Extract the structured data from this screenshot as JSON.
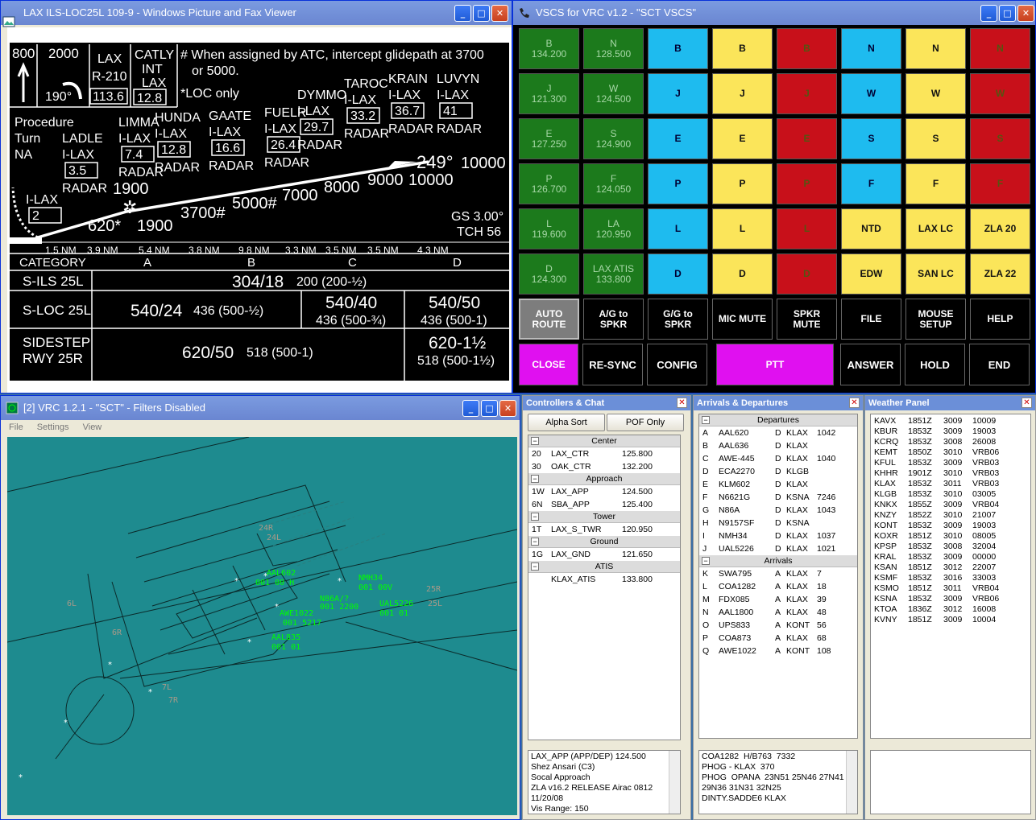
{
  "plate_window": {
    "title": "LAX ILS-LOC25L 109-9 - Windows Picture and Fax Viewer"
  },
  "plate": {
    "t800": "800",
    "t2000": "2000",
    "t190": "190°",
    "lax": "LAX",
    "r210": "R-210",
    "r1136": "113.6",
    "catly": "CATLY",
    "int": "INT",
    "catlylax": "LAX",
    "c128": "12.8",
    "note1": "# When assigned by ATC, intercept glidepath at 3700",
    "note2": "or 5000.",
    "note3": "*LOC only",
    "proc1": "Procedure",
    "proc2": "Turn",
    "proc3": "NA",
    "fixes": [
      {
        "n": "TAROC",
        "s": "I-LAX",
        "d": "33.2",
        "r": "RADAR"
      },
      {
        "n": "KRAIN",
        "s": "I-LAX",
        "d": "36.7",
        "r": "RADAR"
      },
      {
        "n": "LUVYN",
        "s": "I-LAX",
        "d": "41",
        "r": "RADAR"
      },
      {
        "n": "DYMMO",
        "s": "I-LAX",
        "d": "29.7",
        "r": "RADAR"
      },
      {
        "n": "FUELR",
        "s": "I-LAX",
        "d": "26.4",
        "r": "RADAR"
      },
      {
        "n": "GAATE",
        "s": "I-LAX",
        "d": "16.6",
        "r": "RADAR"
      },
      {
        "n": "HUNDA",
        "s": "I-LAX",
        "d": "12.8",
        "r": "RADAR"
      },
      {
        "n": "LIMMA",
        "s": "I-LAX",
        "d": "7.4",
        "r": "RADAR"
      },
      {
        "n": "LADLE",
        "s": "I-LAX",
        "d": "3.5",
        "r": "RADAR"
      },
      {
        "n": "",
        "s": "I-LAX",
        "d": "2",
        "r": ""
      }
    ],
    "alts": [
      "3700#",
      "5000#",
      "7000",
      "8000",
      "9000",
      "10000",
      "1900",
      "1900",
      "620*"
    ],
    "crs": "249°",
    "a10000": "10000",
    "gs": "GS 3.00°",
    "tch": "TCH 56",
    "dists": [
      "1.5 NM",
      "3.9 NM",
      "5.4 NM",
      "3.8 NM",
      "9.8 NM",
      "3.3 NM",
      "3.5 NM",
      "3.5 NM",
      "4.3 NM"
    ],
    "cat_head": [
      "CATEGORY",
      "A",
      "B",
      "C",
      "D"
    ],
    "sils": "S-ILS 25L",
    "sils_v": "304/18",
    "sils_s": "200 (200-½)",
    "sloc": "S-LOC 25L",
    "sloc_ab": "540/24",
    "sloc_ab_s": "436 (500-½)",
    "sloc_c": "540/40",
    "sloc_c_s": "436 (500-¾)",
    "sloc_d": "540/50",
    "sloc_d_s": "436 (500-1)",
    "side1": "SIDESTEP",
    "side2": "RWY 25R",
    "side_v": "620/50",
    "side_s": "518 (500-1)",
    "side_d": "620-1½",
    "side_d_s": "518 (500-1½)"
  },
  "vscs_window": {
    "title": "VSCS for VRC v1.2 - \"SCT VSCS\""
  },
  "vscs": {
    "grid": [
      [
        {
          "l": "B",
          "f": "134.200",
          "c": "g"
        },
        {
          "l": "N",
          "f": "128.500",
          "c": "g"
        },
        {
          "l": "B",
          "c": "c"
        },
        {
          "l": "B",
          "c": "y"
        },
        {
          "l": "B",
          "c": "r"
        },
        {
          "l": "N",
          "c": "c"
        },
        {
          "l": "N",
          "c": "y"
        },
        {
          "l": "N",
          "c": "r"
        }
      ],
      [
        {
          "l": "J",
          "f": "121.300",
          "c": "g"
        },
        {
          "l": "W",
          "f": "124.500",
          "c": "g"
        },
        {
          "l": "J",
          "c": "c"
        },
        {
          "l": "J",
          "c": "y"
        },
        {
          "l": "J",
          "c": "r"
        },
        {
          "l": "W",
          "c": "c"
        },
        {
          "l": "W",
          "c": "y"
        },
        {
          "l": "W",
          "c": "r"
        }
      ],
      [
        {
          "l": "E",
          "f": "127.250",
          "c": "g"
        },
        {
          "l": "S",
          "f": "124.900",
          "c": "g"
        },
        {
          "l": "E",
          "c": "c"
        },
        {
          "l": "E",
          "c": "y"
        },
        {
          "l": "E",
          "c": "r"
        },
        {
          "l": "S",
          "c": "c"
        },
        {
          "l": "S",
          "c": "y"
        },
        {
          "l": "S",
          "c": "r"
        }
      ],
      [
        {
          "l": "P",
          "f": "126.700",
          "c": "g"
        },
        {
          "l": "F",
          "f": "124.050",
          "c": "g"
        },
        {
          "l": "P",
          "c": "c"
        },
        {
          "l": "P",
          "c": "y"
        },
        {
          "l": "P",
          "c": "r"
        },
        {
          "l": "F",
          "c": "c"
        },
        {
          "l": "F",
          "c": "y"
        },
        {
          "l": "F",
          "c": "r"
        }
      ],
      [
        {
          "l": "L",
          "f": "119.600",
          "c": "g"
        },
        {
          "l": "LA",
          "f": "120.950",
          "c": "g"
        },
        {
          "l": "L",
          "c": "c"
        },
        {
          "l": "L",
          "c": "y"
        },
        {
          "l": "L",
          "c": "r"
        },
        {
          "l": "NTD",
          "c": "y"
        },
        {
          "l": "LAX LC",
          "c": "y"
        },
        {
          "l": "ZLA 20",
          "c": "y"
        }
      ],
      [
        {
          "l": "D",
          "f": "124.300",
          "c": "g"
        },
        {
          "l": "LAX ATIS",
          "f": "133.800",
          "c": "g"
        },
        {
          "l": "D",
          "c": "c"
        },
        {
          "l": "D",
          "c": "y"
        },
        {
          "l": "D",
          "c": "r"
        },
        {
          "l": "EDW",
          "c": "y"
        },
        {
          "l": "SAN LC",
          "c": "y"
        },
        {
          "l": "ZLA 22",
          "c": "y"
        }
      ]
    ],
    "row7": [
      {
        "l": "AUTO",
        "f": "ROUTE",
        "c": "gr"
      },
      {
        "l": "A/G to",
        "f": "SPKR",
        "c": "b"
      },
      {
        "l": "G/G to",
        "f": "SPKR",
        "c": "b"
      },
      {
        "l": "MIC MUTE",
        "c": "b"
      },
      {
        "l": "SPKR",
        "f": "MUTE",
        "c": "b"
      },
      {
        "l": "FILE",
        "c": "b"
      },
      {
        "l": "MOUSE",
        "f": "SETUP",
        "c": "b"
      },
      {
        "l": "HELP",
        "c": "b"
      }
    ],
    "close": "CLOSE",
    "resync": "RE-SYNC",
    "config": "CONFIG",
    "ptt": "PTT",
    "answer": "ANSWER",
    "hold": "HOLD",
    "end": "END"
  },
  "vrc_window": {
    "title": "[2] VRC 1.2.1 - \"SCT\" - Filters Disabled",
    "menu": [
      "File",
      "Settings",
      "View"
    ]
  },
  "scope": {
    "labels": [
      "AAL602",
      "001 00 H",
      "NMH34",
      "001 00V",
      "N86A/?",
      "001 2200",
      "UAL5226",
      "001 01",
      "AWE1022",
      "001 5217",
      "AAL835",
      "001 01",
      "24R",
      "24L",
      "25R",
      "25L",
      "6L",
      "7L",
      "7R",
      "6R"
    ]
  },
  "controllers": {
    "title": "Controllers & Chat",
    "alpha": "Alpha Sort",
    "pof": "POF Only",
    "groups": [
      {
        "name": "Center",
        "rows": [
          [
            "20",
            "LAX_CTR",
            "125.800"
          ],
          [
            "30",
            "OAK_CTR",
            "132.200"
          ]
        ]
      },
      {
        "name": "Approach",
        "rows": [
          [
            "1W",
            "LAX_APP",
            "124.500"
          ],
          [
            "6N",
            "SBA_APP",
            "125.400"
          ]
        ]
      },
      {
        "name": "Tower",
        "rows": [
          [
            "1T",
            "LAX_S_TWR",
            "120.950"
          ]
        ]
      },
      {
        "name": "Ground",
        "rows": [
          [
            "1G",
            "LAX_GND",
            "121.650"
          ]
        ]
      },
      {
        "name": "ATIS",
        "rows": [
          [
            "",
            "KLAX_ATIS",
            "133.800"
          ]
        ]
      }
    ],
    "info": "LAX_APP (APP/DEP) 124.500\nShez Ansari (C3)\nSocal Approach\nZLA v16.2 RELEASE Airac 0812\n11/20/08\nVis Range: 150"
  },
  "arrdep": {
    "title": "Arrivals & Departures",
    "dep_head": "Departures",
    "departures": [
      [
        "A",
        "AAL620",
        "D",
        "KLAX",
        "1042"
      ],
      [
        "B",
        "AAL636",
        "D",
        "KLAX",
        ""
      ],
      [
        "C",
        "AWE-445",
        "D",
        "KLAX",
        "1040"
      ],
      [
        "D",
        "ECA2270",
        "D",
        "KLGB",
        ""
      ],
      [
        "E",
        "KLM602",
        "D",
        "KLAX",
        ""
      ],
      [
        "F",
        "N6621G",
        "D",
        "KSNA",
        "7246"
      ],
      [
        "G",
        "N86A",
        "D",
        "KLAX",
        "1043"
      ],
      [
        "H",
        "N9157SF",
        "D",
        "KSNA",
        ""
      ],
      [
        "I",
        "NMH34",
        "D",
        "KLAX",
        "1037"
      ],
      [
        "J",
        "UAL5226",
        "D",
        "KLAX",
        "1021"
      ]
    ],
    "arr_head": "Arrivals",
    "arrivals": [
      [
        "K",
        "SWA795",
        "A",
        "KLAX",
        "7"
      ],
      [
        "L",
        "COA1282",
        "A",
        "KLAX",
        "18"
      ],
      [
        "M",
        "FDX085",
        "A",
        "KLAX",
        "39"
      ],
      [
        "N",
        "AAL1800",
        "A",
        "KLAX",
        "48"
      ],
      [
        "O",
        "UPS833",
        "A",
        "KONT",
        "56"
      ],
      [
        "P",
        "COA873",
        "A",
        "KLAX",
        "68"
      ],
      [
        "Q",
        "AWE1022",
        "A",
        "KONT",
        "108"
      ]
    ],
    "info": "COA1282  H/B763  7332\nPHOG - KLAX  370\nPHOG  OPANA  23N51 25N46 27N41\n29N36 31N31 32N25\nDINTY.SADDE6 KLAX"
  },
  "weather": {
    "title": "Weather Panel",
    "rows": [
      [
        "KAVX",
        "1851Z",
        "3009",
        "10009"
      ],
      [
        "KBUR",
        "1853Z",
        "3009",
        "19003"
      ],
      [
        "KCRQ",
        "1853Z",
        "3008",
        "26008"
      ],
      [
        "KEMT",
        "1850Z",
        "3010",
        "VRB06"
      ],
      [
        "KFUL",
        "1853Z",
        "3009",
        "VRB03"
      ],
      [
        "KHHR",
        "1901Z",
        "3010",
        "VRB03"
      ],
      [
        "KLAX",
        "1853Z",
        "3011",
        "VRB03"
      ],
      [
        "KLGB",
        "1853Z",
        "3010",
        "03005"
      ],
      [
        "KNKX",
        "1855Z",
        "3009",
        "VRB04"
      ],
      [
        "KNZY",
        "1852Z",
        "3010",
        "21007"
      ],
      [
        "KONT",
        "1853Z",
        "3009",
        "19003"
      ],
      [
        "KOXR",
        "1851Z",
        "3010",
        "08005"
      ],
      [
        "KPSP",
        "1853Z",
        "3008",
        "32004"
      ],
      [
        "KRAL",
        "1853Z",
        "3009",
        "00000"
      ],
      [
        "KSAN",
        "1851Z",
        "3012",
        "22007"
      ],
      [
        "KSMF",
        "1853Z",
        "3016",
        "33003"
      ],
      [
        "KSMO",
        "1851Z",
        "3011",
        "VRB04"
      ],
      [
        "KSNA",
        "1853Z",
        "3009",
        "VRB06"
      ],
      [
        "KTOA",
        "1836Z",
        "3012",
        "16008"
      ],
      [
        "KVNY",
        "1851Z",
        "3009",
        "10004"
      ]
    ]
  }
}
